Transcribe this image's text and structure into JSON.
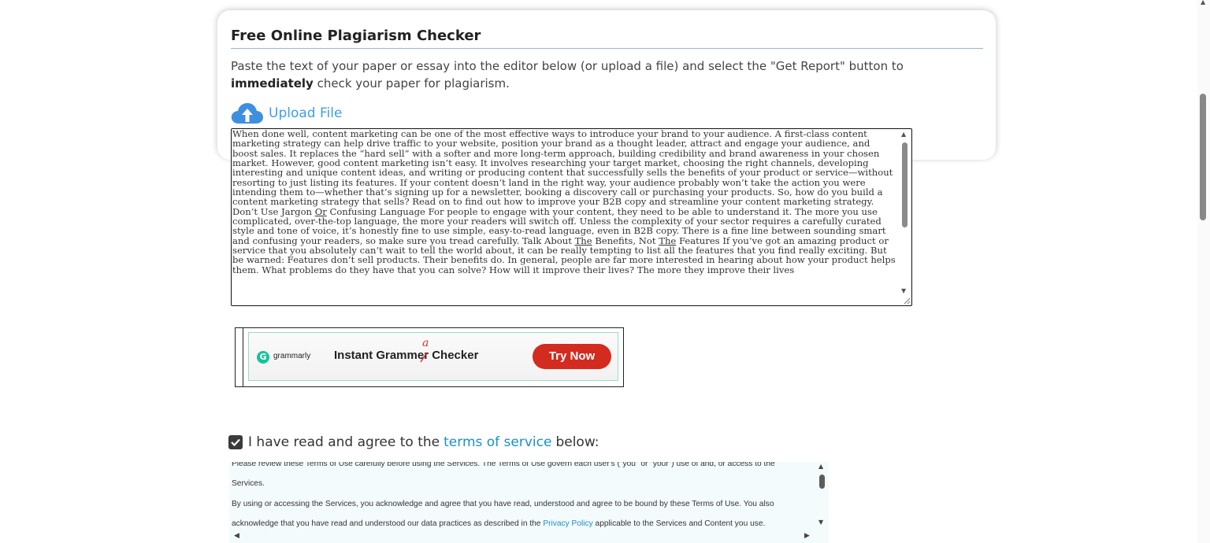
{
  "checker": {
    "title": "Free Online Plagiarism Checker",
    "intro_before": "Paste the text of your paper or essay into the editor below (or upload a file) and select the \"Get Report\" button to ",
    "intro_bold": "immediately",
    "intro_after": " check your paper for plagiarism.",
    "upload_label": "Upload File",
    "upload_icon": "cloud-upload-icon",
    "accent_color": "#3f9fe6"
  },
  "editor": {
    "text_1": "When done well, content marketing can be one of the most effective ways to introduce your brand to your audience. A first-class content marketing strategy can help drive traffic to your website, position your brand as a thought leader, attract and engage your audience, and boost sales. It replaces the “hard sell” with a softer and more long-term approach, building credibility and brand awareness in your chosen market. However, good content marketing isn’t easy. It involves researching your target market, choosing the right channels, developing interesting and unique content ideas, and writing or producing content that successfully sells the benefits of your product or service—without resorting to just listing its features. If your content doesn’t land in the right way, your audience probably won’t take the action you were intending them to—whether that’s signing up for a newsletter, booking a discovery call or purchasing your products. So, how do you build a content marketing strategy that sells? Read on to find out how to improve your B2B copy and streamline your content marketing strategy. Don’t Use Jargon ",
    "flag_1": "Or",
    "text_2": " Confusing Language For people to engage with your content, they need to be able to understand it. The more you use complicated, over-the-top language, the more your readers will switch off. Unless the complexity of your sector requires a carefully curated style and tone of voice, it’s honestly fine to use simple, easy-to-read language, even in B2B copy. There is a fine line between sounding smart and confusing your readers, so make sure you tread carefully. Talk About ",
    "flag_2": "The",
    "text_3": " Benefits, Not ",
    "flag_3": "The",
    "text_4": " Features If you’ve got an amazing product or service that you absolutely can’t wait to tell the world about, it can be really tempting to list all the features that you find really exciting. But be warned: Features don’t sell products. Their benefits do. In general, people are far more interested in hearing about how your product helps them. What problems do they have that you can solve? How will it improve their lives? The more they improve their lives"
  },
  "ad": {
    "brand": "grammarly",
    "brand_logo": "G",
    "headline": "Instant Grammer Checker",
    "correction": "a",
    "cta": "Try Now",
    "brand_color": "#15c39a",
    "cta_color": "#d32b1f"
  },
  "agreement": {
    "checked": true,
    "lead": "I have read and agree to the",
    "link": "terms of service",
    "trail": "below:",
    "link_color": "#1b8fc7"
  },
  "terms": {
    "line_0": "Please review these Terms of Use carefully before using the Services. The Terms of Use govern each user's (\"you\" or \"your\") use of and, or access to the",
    "line_1": "Services.",
    "para_2_before": "By using or accessing the Services, you acknowledge and agree that you have read, understood and agree to be bound by these Terms of Use. You also acknowledge that you have read and understood our data practices as described in the ",
    "privacy_link": "Privacy Policy",
    "para_2_after": " applicable to the Services and Content you use."
  }
}
